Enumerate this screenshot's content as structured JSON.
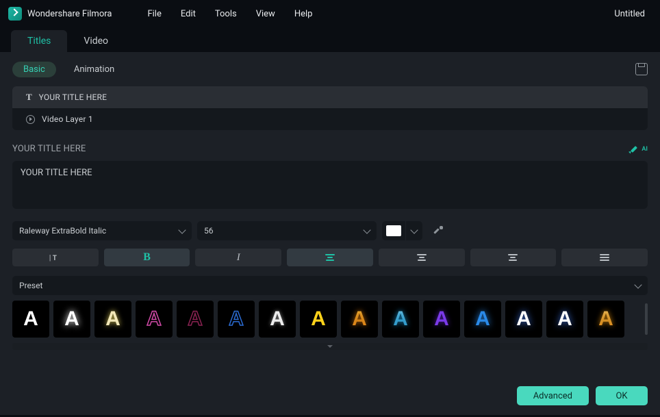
{
  "app": {
    "name": "Wondershare Filmora",
    "document": "Untitled"
  },
  "menu": {
    "items": [
      "File",
      "Edit",
      "Tools",
      "View",
      "Help"
    ]
  },
  "primaryTabs": {
    "items": [
      "Titles",
      "Video"
    ],
    "activeIndex": 0
  },
  "subTabs": {
    "items": [
      "Basic",
      "Animation"
    ],
    "activeIndex": 0
  },
  "layers": {
    "items": [
      {
        "icon": "text",
        "label": "YOUR TITLE HERE",
        "selected": true
      },
      {
        "icon": "video",
        "label": "Video Layer 1",
        "selected": false
      }
    ]
  },
  "heading": "YOUR TITLE HERE",
  "aiLabel": "AI",
  "textValue": "YOUR TITLE HERE",
  "font": {
    "family": "Raleway ExtraBold Italic",
    "size": "56",
    "colorHex": "#FFFFFF"
  },
  "tools": {
    "spacing": {
      "on": false
    },
    "bold": {
      "on": true
    },
    "italic": {
      "on": false
    },
    "alignLeftAccent": {
      "on": true
    },
    "alignCenter": {
      "on": false
    },
    "alignRight": {
      "on": false
    },
    "alignJustify": {
      "on": false
    }
  },
  "presetLabel": "Preset",
  "presets": [
    {
      "fill": "#FFFFFF",
      "stroke": "none",
      "shadow": "none"
    },
    {
      "fill": "#FFFFFF",
      "stroke": "none",
      "shadow": "0 0 10px #fff"
    },
    {
      "fill": "#F2E8B8",
      "stroke": "none",
      "shadow": "0 0 8px #d9c85a"
    },
    {
      "fill": "transparent",
      "stroke": "#d24aa8",
      "shadow": "none",
      "strokeWidth": "1.5px"
    },
    {
      "fill": "transparent",
      "stroke": "#8a2252",
      "shadow": "none",
      "strokeWidth": "1.5px"
    },
    {
      "fill": "transparent",
      "stroke": "#2b6bd1",
      "shadow": "none",
      "strokeWidth": "1.5px"
    },
    {
      "fill": "#EDEDED",
      "stroke": "none",
      "shadow": "0 0 6px #888"
    },
    {
      "fill": "#FFD21A",
      "stroke": "none",
      "shadow": "none"
    },
    {
      "fill": "#F59A1A",
      "stroke": "none",
      "shadow": "0 0 8px #c06a0a",
      "grad": "linear-gradient(#ffd24a,#e07a10)"
    },
    {
      "fill": "#4AC8F0",
      "stroke": "none",
      "shadow": "0 0 8px #1a8ac0",
      "grad": "linear-gradient(#9ae2f7,#1a8ac0)"
    },
    {
      "fill": "#7A3AE8",
      "stroke": "none",
      "shadow": "0 0 8px #5020a8"
    },
    {
      "fill": "#2A8AE8",
      "stroke": "none",
      "shadow": "0 0 10px #2a8ae8"
    },
    {
      "fill": "#FFFFFF",
      "stroke": "none",
      "shadow": "0 0 10px #3a6ad0"
    },
    {
      "fill": "#FFFFFF",
      "stroke": "none",
      "shadow": "0 0 10px #3a6ad0"
    },
    {
      "fill": "#F5A81A",
      "stroke": "none",
      "shadow": "0 0 8px #c07a0a",
      "grad": "linear-gradient(#ffe08a,#d97a0a)"
    }
  ],
  "buttons": {
    "advanced": "Advanced",
    "ok": "OK"
  }
}
